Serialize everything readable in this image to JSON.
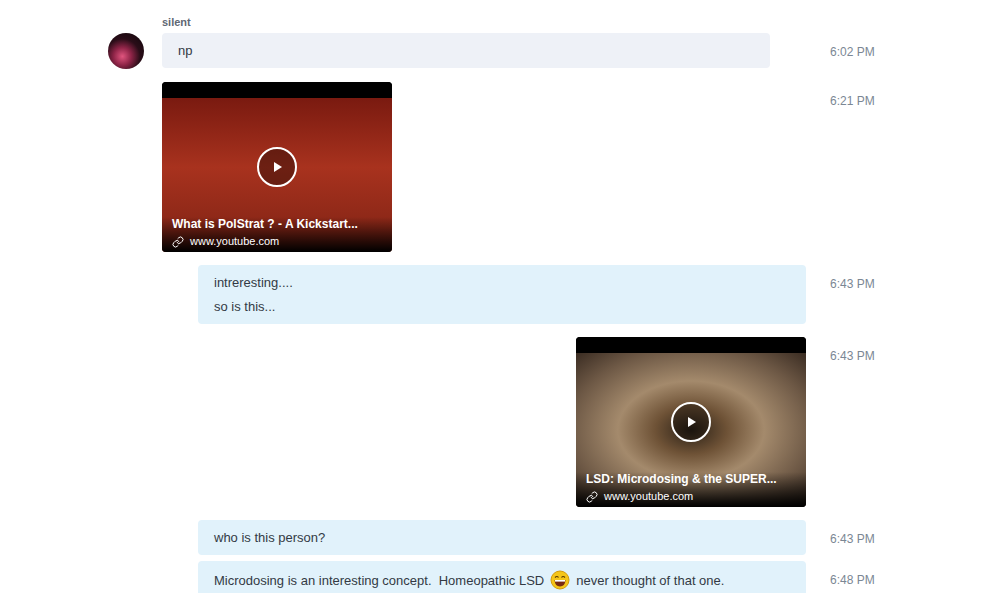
{
  "conversation": {
    "messages": [
      {
        "sender": "silent",
        "direction": "incoming",
        "kind": "text",
        "show_sender": true,
        "time": "6:02 PM",
        "lines": [
          [
            {
              "kind": "text",
              "text": "np"
            }
          ]
        ]
      },
      {
        "sender": "silent",
        "direction": "incoming",
        "kind": "video",
        "show_sender": false,
        "time": "6:21 PM",
        "video": {
          "title": "What is PolStrat ? - A Kickstart...",
          "source": "www.youtube.com",
          "tone": "red"
        }
      },
      {
        "sender": "me",
        "direction": "outgoing",
        "kind": "text",
        "show_sender": false,
        "time": "6:43 PM",
        "lines": [
          [
            {
              "kind": "text",
              "text": "intreresting...."
            }
          ],
          [
            {
              "kind": "text",
              "text": "so is this..."
            }
          ]
        ]
      },
      {
        "sender": "me",
        "direction": "outgoing",
        "kind": "video",
        "show_sender": false,
        "time": "6:43 PM",
        "video": {
          "title": "LSD: Microdosing & the SUPER...",
          "source": "www.youtube.com",
          "tone": "eye"
        }
      },
      {
        "sender": "me",
        "direction": "outgoing",
        "kind": "text",
        "show_sender": false,
        "time": "6:43 PM",
        "lines": [
          [
            {
              "kind": "text",
              "text": "who is this person?"
            }
          ]
        ]
      },
      {
        "sender": "me",
        "direction": "outgoing",
        "kind": "text",
        "show_sender": false,
        "time": "6:48 PM",
        "lines": [
          [
            {
              "kind": "text",
              "text": "Microdosing is an interesting concept.  Homeopathic LSD"
            },
            {
              "kind": "emoji"
            },
            {
              "kind": "text",
              "text": "never thought of that one."
            }
          ]
        ]
      }
    ]
  }
}
